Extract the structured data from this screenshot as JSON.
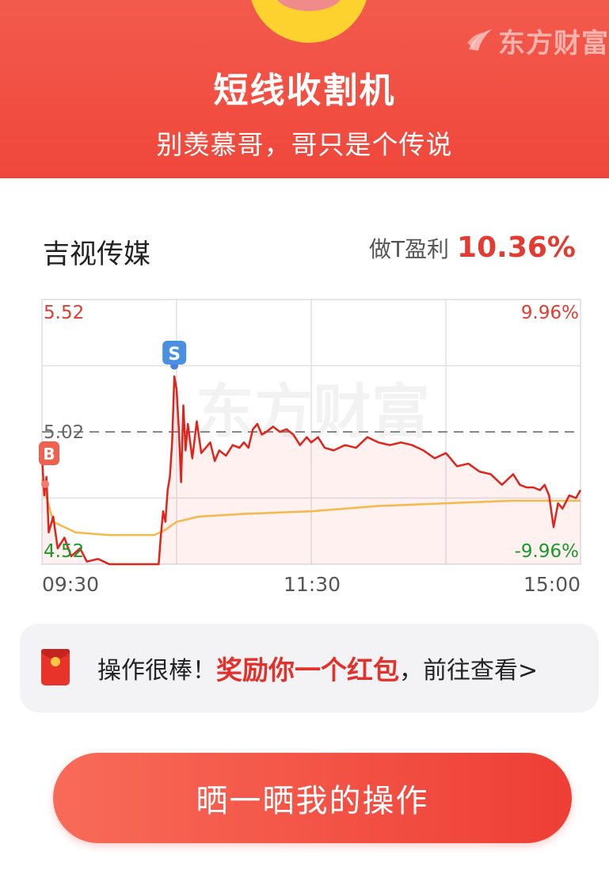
{
  "header": {
    "brand": "东方财富",
    "title": "短线收割机",
    "subtitle": "别羡慕哥，哥只是个传说"
  },
  "stock": {
    "name": "吉视传媒",
    "profit_label": "做T盈利",
    "profit_value": "10.36%"
  },
  "chart_data": {
    "type": "line",
    "watermark": "东方财富",
    "y_axis_left": {
      "top": "5.52",
      "middle": "5.02",
      "bottom": "4.52"
    },
    "y_axis_right": {
      "top": "9.96%",
      "bottom": "-9.96%"
    },
    "ylim": [
      4.52,
      5.52
    ],
    "reference_price": 5.02,
    "x_ticks": [
      "09:30",
      "11:30",
      "15:00"
    ],
    "grid": true,
    "markers": [
      {
        "label": "B",
        "time": "09:30",
        "price": 4.93
      },
      {
        "label": "S",
        "time": "10:29",
        "price": 5.27
      }
    ],
    "series": [
      {
        "kind": "price",
        "color": "#e0241b",
        "points": [
          [
            "09:30",
            4.93
          ],
          [
            "09:31",
            4.78
          ],
          [
            "09:32",
            4.85
          ],
          [
            "09:33",
            4.64
          ],
          [
            "09:35",
            4.7
          ],
          [
            "09:37",
            4.58
          ],
          [
            "09:40",
            4.62
          ],
          [
            "09:43",
            4.55
          ],
          [
            "09:47",
            4.58
          ],
          [
            "09:50",
            4.53
          ],
          [
            "09:55",
            4.54
          ],
          [
            "10:00",
            4.52
          ],
          [
            "10:05",
            4.52
          ],
          [
            "10:10",
            4.52
          ],
          [
            "10:20",
            4.52
          ],
          [
            "10:22",
            4.52
          ],
          [
            "10:23",
            4.63
          ],
          [
            "10:24",
            4.72
          ],
          [
            "10:25",
            4.68
          ],
          [
            "10:26",
            4.8
          ],
          [
            "10:27",
            4.85
          ],
          [
            "10:28",
            4.98
          ],
          [
            "10:29",
            5.23
          ],
          [
            "10:30",
            5.18
          ],
          [
            "10:31",
            5.03
          ],
          [
            "10:32",
            4.83
          ],
          [
            "10:33",
            5.12
          ],
          [
            "10:34",
            4.95
          ],
          [
            "10:35",
            5.05
          ],
          [
            "10:37",
            4.92
          ],
          [
            "10:39",
            5.06
          ],
          [
            "10:41",
            4.94
          ],
          [
            "10:43",
            4.96
          ],
          [
            "10:45",
            4.98
          ],
          [
            "10:47",
            4.91
          ],
          [
            "10:49",
            4.95
          ],
          [
            "10:52",
            4.93
          ],
          [
            "10:55",
            4.97
          ],
          [
            "10:58",
            4.96
          ],
          [
            "11:00",
            4.98
          ],
          [
            "11:02",
            4.96
          ],
          [
            "11:04",
            5.03
          ],
          [
            "11:06",
            5.05
          ],
          [
            "11:08",
            5.01
          ],
          [
            "11:10",
            5.02
          ],
          [
            "11:13",
            5.04
          ],
          [
            "11:16",
            5.02
          ],
          [
            "11:19",
            5.03
          ],
          [
            "11:22",
            5.01
          ],
          [
            "11:25",
            4.97
          ],
          [
            "11:28",
            5.0
          ],
          [
            "11:30",
            4.98
          ],
          [
            "13:03",
            5.0
          ],
          [
            "13:06",
            4.96
          ],
          [
            "13:10",
            4.95
          ],
          [
            "13:15",
            4.97
          ],
          [
            "13:20",
            4.96
          ],
          [
            "13:25",
            5.0
          ],
          [
            "13:30",
            4.98
          ],
          [
            "13:35",
            4.97
          ],
          [
            "13:40",
            4.98
          ],
          [
            "13:45",
            4.97
          ],
          [
            "13:50",
            4.95
          ],
          [
            "13:55",
            4.92
          ],
          [
            "14:00",
            4.94
          ],
          [
            "14:05",
            4.89
          ],
          [
            "14:10",
            4.9
          ],
          [
            "14:15",
            4.87
          ],
          [
            "14:20",
            4.86
          ],
          [
            "14:25",
            4.82
          ],
          [
            "14:30",
            4.86
          ],
          [
            "14:33",
            4.82
          ],
          [
            "14:36",
            4.81
          ],
          [
            "14:39",
            4.81
          ],
          [
            "14:42",
            4.8
          ],
          [
            "14:44",
            4.82
          ],
          [
            "14:46",
            4.78
          ],
          [
            "14:48",
            4.66
          ],
          [
            "14:50",
            4.75
          ],
          [
            "14:52",
            4.73
          ],
          [
            "14:55",
            4.78
          ],
          [
            "14:58",
            4.77
          ],
          [
            "15:00",
            4.8
          ]
        ]
      },
      {
        "kind": "average",
        "color": "#f5b84a",
        "points": [
          [
            "09:30",
            4.84
          ],
          [
            "09:35",
            4.68
          ],
          [
            "09:45",
            4.64
          ],
          [
            "10:00",
            4.63
          ],
          [
            "10:20",
            4.63
          ],
          [
            "10:25",
            4.65
          ],
          [
            "10:30",
            4.68
          ],
          [
            "10:40",
            4.7
          ],
          [
            "11:00",
            4.71
          ],
          [
            "11:30",
            4.72
          ],
          [
            "13:30",
            4.74
          ],
          [
            "14:00",
            4.75
          ],
          [
            "14:30",
            4.76
          ],
          [
            "15:00",
            4.76
          ]
        ]
      }
    ]
  },
  "reward": {
    "prefix": "操作很棒！",
    "highlight": "奖励你一个红包",
    "link": "，前往查看>"
  },
  "share_button": {
    "label": "晒一晒我的操作"
  },
  "colors": {
    "header_bg": "#f0473b",
    "accent_red": "#e23b32",
    "price_line": "#e0241b",
    "average_line": "#f5b84a",
    "down_green": "#1a9a2c"
  }
}
